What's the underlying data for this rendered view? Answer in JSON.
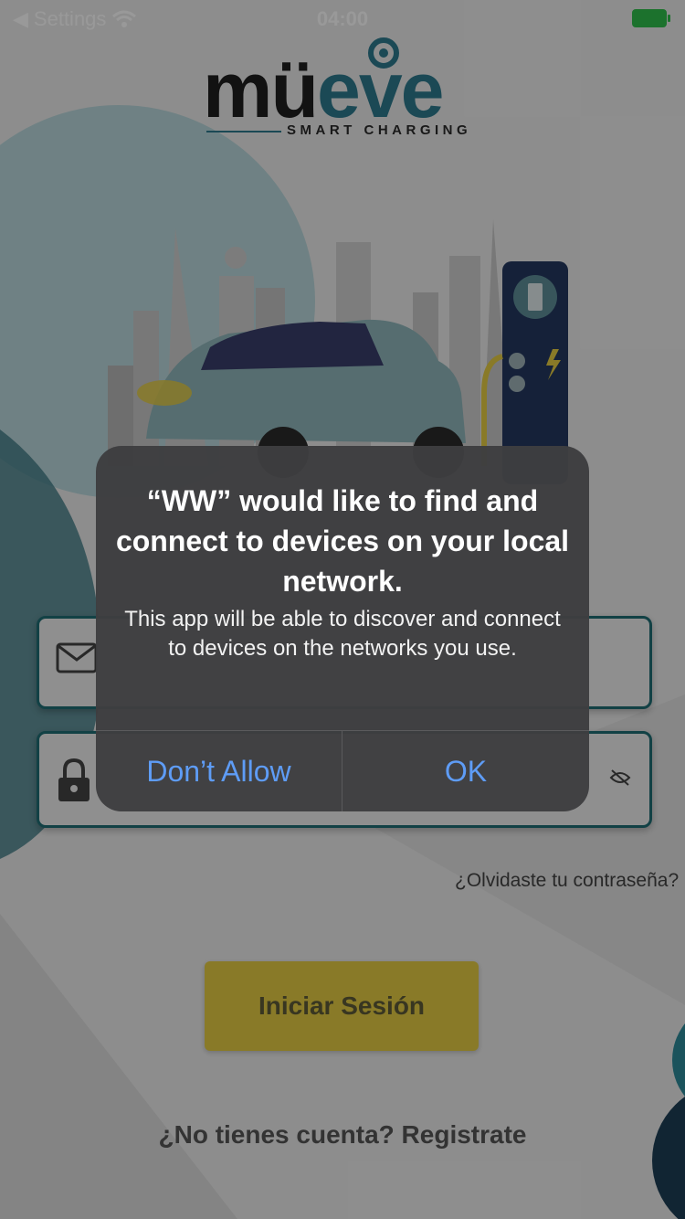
{
  "status_bar": {
    "back_label": "Settings",
    "time": "04:00"
  },
  "logo": {
    "word_part1": "mü",
    "word_accent": "eve",
    "subtitle": "SMART CHARGING"
  },
  "login": {
    "forgot_password": "¿Olvidaste tu contraseña?",
    "submit_label": "Iniciar Sesión",
    "register_prompt": "¿No tienes cuenta? Registrate"
  },
  "alert": {
    "title": "“WW” would like to find and connect to devices on your local network.",
    "message": "This app will be able to discover and connect to devices on the networks you use.",
    "deny_label": "Don’t Allow",
    "ok_label": "OK"
  },
  "colors": {
    "accent": "#2d7a8e",
    "button": "#e4cc44",
    "alert_link": "#5e9cf6",
    "battery": "#2fbf4b"
  }
}
